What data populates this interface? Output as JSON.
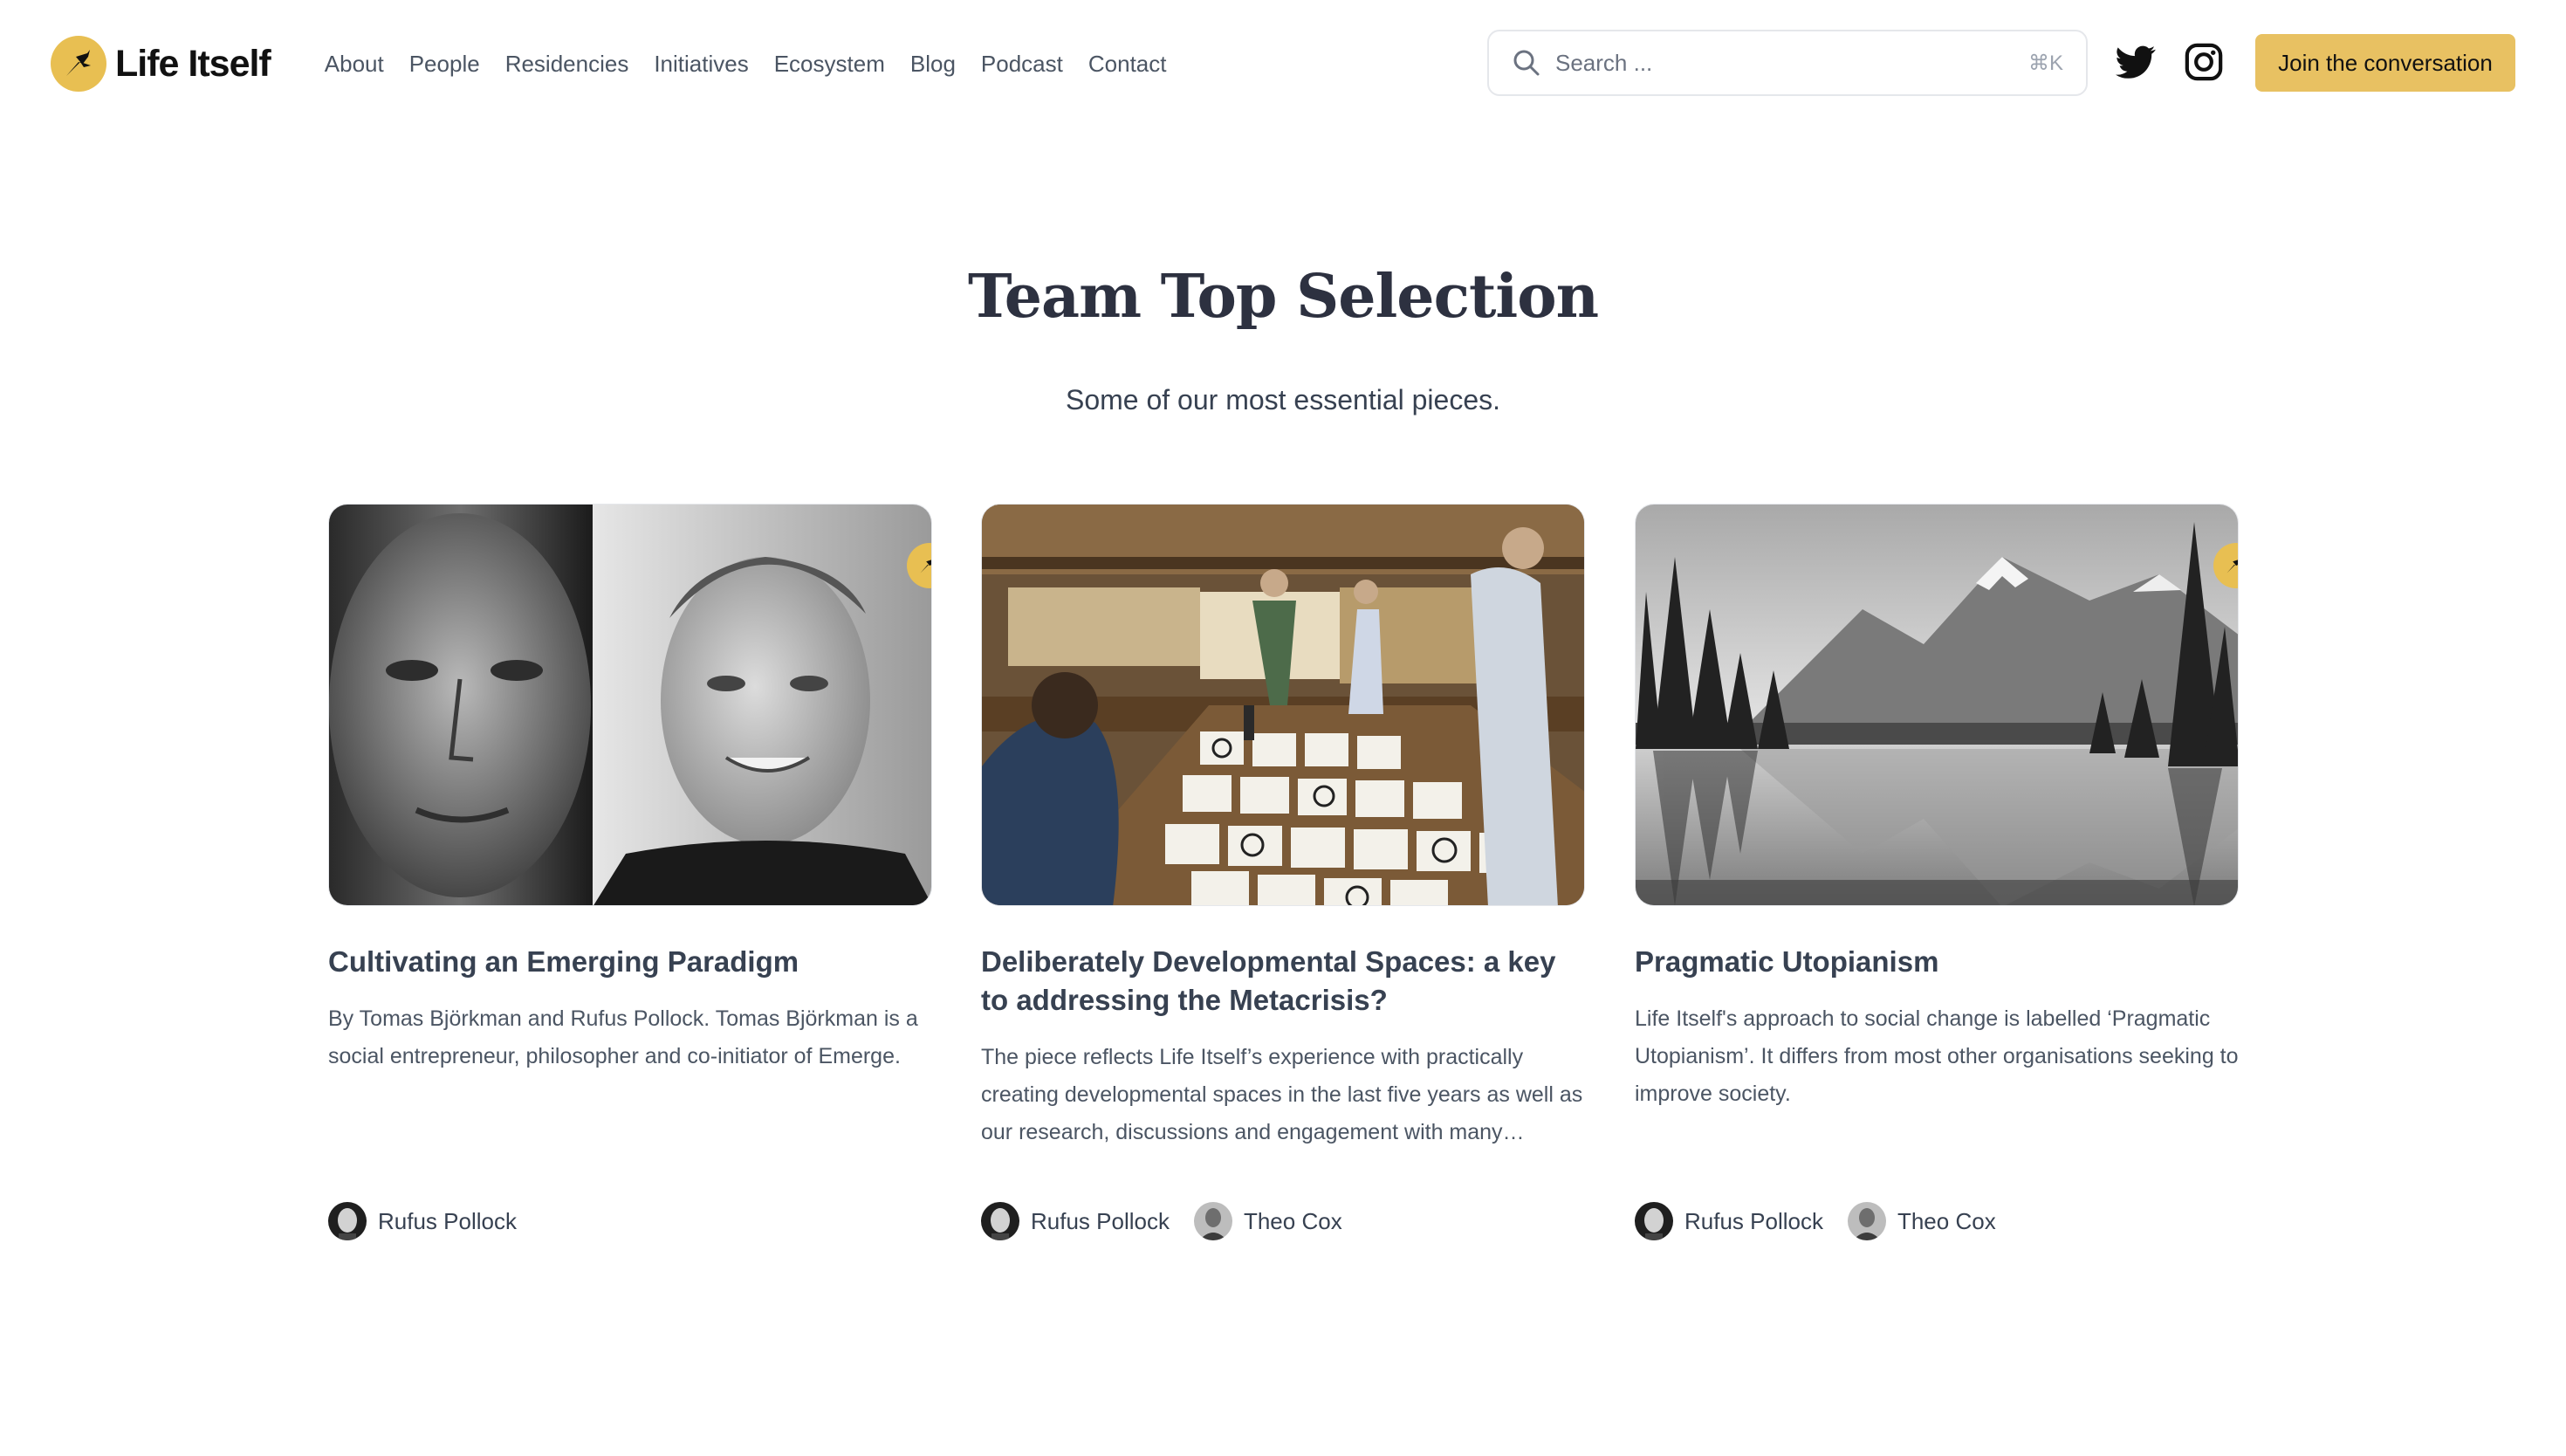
{
  "brand": {
    "name": "Life Itself",
    "accent": "#e8bf52"
  },
  "nav": [
    {
      "label": "About"
    },
    {
      "label": "People"
    },
    {
      "label": "Residencies"
    },
    {
      "label": "Initiatives"
    },
    {
      "label": "Ecosystem"
    },
    {
      "label": "Blog"
    },
    {
      "label": "Podcast"
    },
    {
      "label": "Contact"
    }
  ],
  "search": {
    "placeholder": "Search ...",
    "shortcut": "⌘K",
    "icon": "search-icon"
  },
  "social": [
    {
      "icon": "twitter-icon"
    },
    {
      "icon": "instagram-icon"
    }
  ],
  "cta": {
    "label": "Join the conversation"
  },
  "section": {
    "title": "Team Top Selection",
    "subtitle": "Some of our most essential pieces."
  },
  "cards": [
    {
      "title": "Cultivating an Emerging Paradigm",
      "description": "By Tomas Björkman and Rufus Pollock. Tomas Björkman is a social entrepreneur, philosopher and co-initiator of Emerge.",
      "image": "two-portraits-photo",
      "authors": [
        {
          "name": "Rufus Pollock"
        }
      ]
    },
    {
      "title": "Deliberately Developmental Spaces: a key to addressing the Metacrisis?",
      "description": "The piece reflects Life Itself’s experience with practically creating developmental spaces in the last five years as well as our research, discussions and engagement with many…",
      "image": "workshop-photo",
      "authors": [
        {
          "name": "Rufus Pollock"
        },
        {
          "name": "Theo Cox"
        }
      ]
    },
    {
      "title": "Pragmatic Utopianism",
      "description": "Life Itself's approach to social change is labelled ‘Pragmatic Utopianism’. It differs from most other organisations seeking to improve society.",
      "image": "mountain-lake-photo",
      "authors": [
        {
          "name": "Rufus Pollock"
        },
        {
          "name": "Theo Cox"
        }
      ]
    }
  ]
}
